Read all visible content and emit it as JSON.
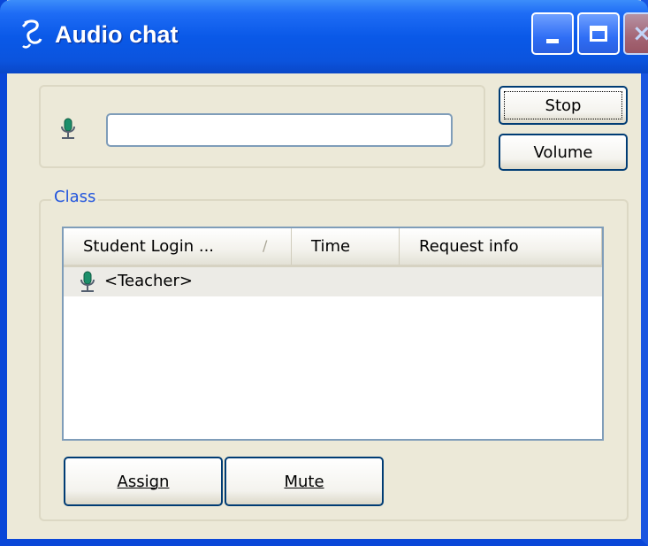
{
  "window": {
    "title": "Audio chat",
    "controls": {
      "minimize": "minimize",
      "maximize": "maximize",
      "close": "×"
    }
  },
  "audio": {
    "stop_label": "Stop",
    "volume_label": "Volume",
    "level_value": ""
  },
  "class_group": {
    "legend": "Class",
    "columns": [
      "Student Login ...",
      "Time",
      "Request info"
    ],
    "sort_indicator": "/",
    "rows": [
      {
        "name": "<Teacher>",
        "time": "",
        "request_info": "",
        "icon": "microphone-icon"
      }
    ]
  },
  "actions": {
    "assign_label": "Assign",
    "mute_label": "Mute"
  },
  "colors": {
    "title_bar": "#0a59e8",
    "window_face": "#ece9d8",
    "group_legend": "#2255dd",
    "button_border": "#003c74"
  }
}
